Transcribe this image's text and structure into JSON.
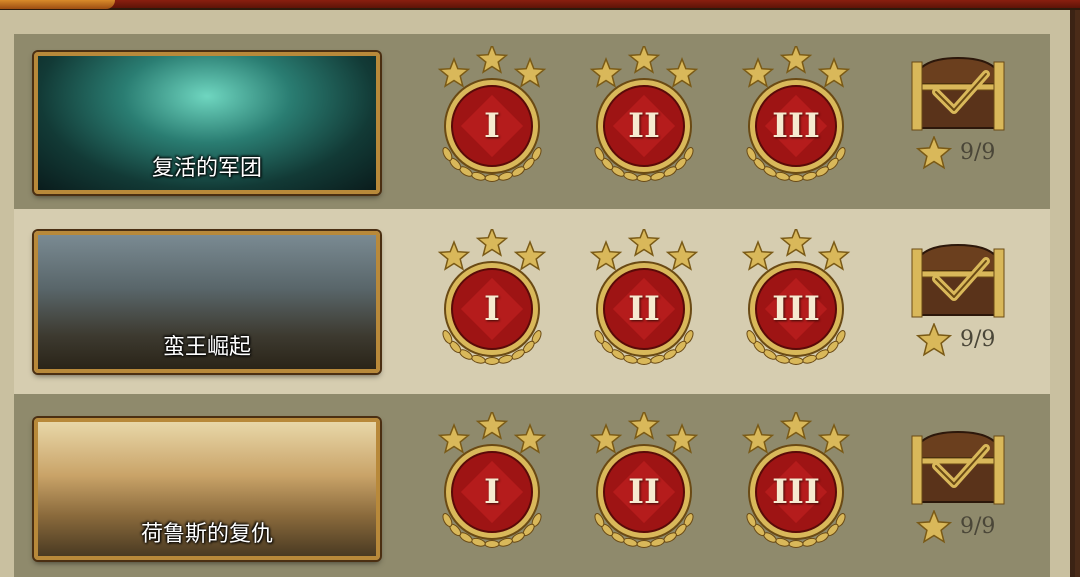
{
  "campaigns": [
    {
      "title": "复活的军团",
      "medals": [
        {
          "numeral": "I",
          "stars": 3
        },
        {
          "numeral": "II",
          "stars": 3
        },
        {
          "numeral": "III",
          "stars": 3
        }
      ],
      "reward": {
        "icon": "treasure-chest-checked-icon",
        "progress": "9/9"
      }
    },
    {
      "title": "蛮王崛起",
      "medals": [
        {
          "numeral": "I",
          "stars": 3
        },
        {
          "numeral": "II",
          "stars": 3
        },
        {
          "numeral": "III",
          "stars": 3
        }
      ],
      "reward": {
        "icon": "treasure-chest-checked-icon",
        "progress": "9/9"
      }
    },
    {
      "title": "荷鲁斯的复仇",
      "medals": [
        {
          "numeral": "I",
          "stars": 3
        },
        {
          "numeral": "II",
          "stars": 3
        },
        {
          "numeral": "III",
          "stars": 3
        }
      ],
      "reward": {
        "icon": "treasure-chest-checked-icon",
        "progress": "9/9"
      }
    }
  ],
  "colors": {
    "medal_red": "#9e1414",
    "gold": "#d9b85a",
    "panel": "#c9c0a0"
  }
}
